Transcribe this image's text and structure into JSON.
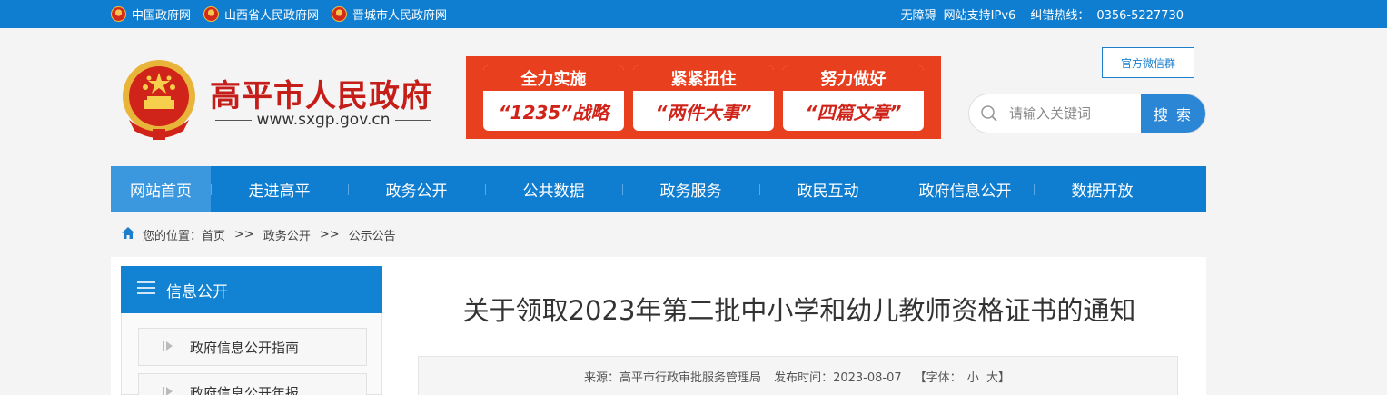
{
  "topbar": {
    "links": [
      "中国政府网",
      "山西省人民政府网",
      "晋城市人民政府网"
    ],
    "accessibility": "无障碍",
    "ipv6": "网站支持IPv6",
    "hotline_label": "纠错热线：",
    "hotline": "0356-5227730"
  },
  "header": {
    "title": "高平市人民政府",
    "url": "www.sxgp.gov.cn"
  },
  "banner": {
    "cards": [
      {
        "top": "全力实施",
        "bottom": "“1235”战略"
      },
      {
        "top": "紧紧扭住",
        "bottom": "“两件大事”"
      },
      {
        "top": "努力做好",
        "bottom": "“四篇文章”"
      }
    ]
  },
  "wechat_label": "官方微信群",
  "search": {
    "placeholder": "请输入关键词",
    "button": "搜 索"
  },
  "nav": [
    "网站首页",
    "走进高平",
    "政务公开",
    "公共数据",
    "政务服务",
    "政民互动",
    "政府信息公开",
    "数据开放"
  ],
  "breadcrumb": {
    "label": "您的位置：",
    "items": [
      "首页",
      "政务公开",
      "公示公告"
    ],
    "sep": ">>"
  },
  "sidebar": {
    "title": "信息公开",
    "items": [
      "政府信息公开指南",
      "政府信息公开年报"
    ]
  },
  "article": {
    "title": "关于领取2023年第二批中小学和幼儿教师资格证书的通知",
    "source_label": "来源：",
    "source": "高平市行政审批服务管理局",
    "date_label": "发布时间：",
    "date": "2023-08-07",
    "font_label": "【字体：",
    "font_small": "小",
    "font_large": "大】"
  },
  "colors": {
    "primary_blue": "#0f7ed0",
    "brand_red": "#c51d18",
    "banner_orange": "#e8401f"
  }
}
